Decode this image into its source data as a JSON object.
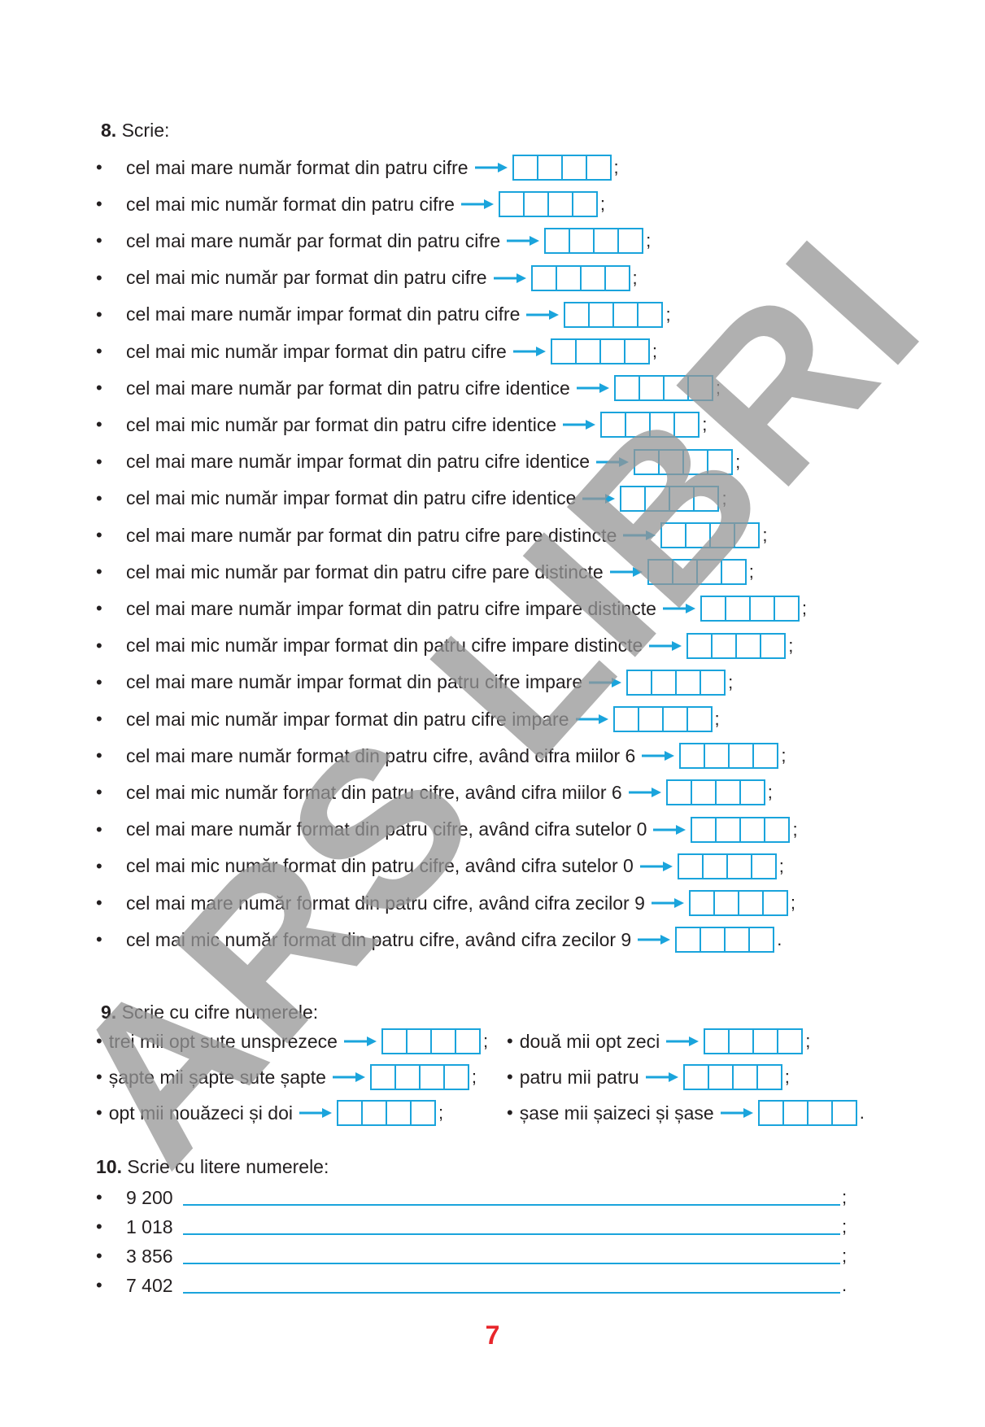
{
  "ex8": {
    "number": "8.",
    "title": "Scrie:",
    "items": [
      {
        "text": "cel mai mare număr format din patru cifre",
        "end": ";"
      },
      {
        "text": "cel mai mic număr format din patru cifre",
        "end": ";"
      },
      {
        "text": "cel mai mare număr par format din patru cifre",
        "end": ";"
      },
      {
        "text": "cel mai mic număr par format din patru cifre",
        "end": ";"
      },
      {
        "text": "cel mai mare număr impar format din patru cifre",
        "end": ";"
      },
      {
        "text": "cel mai mic număr impar format din patru cifre",
        "end": ";"
      },
      {
        "text": "cel mai mare număr par format din patru cifre identice",
        "end": ";"
      },
      {
        "text": "cel mai mic număr par format din patru cifre identice",
        "end": ";"
      },
      {
        "text": "cel mai mare număr impar format din patru cifre identice",
        "end": ";"
      },
      {
        "text": "cel mai mic număr impar format din patru cifre identice",
        "end": ";"
      },
      {
        "text": "cel mai mare număr par format din patru cifre pare distincte",
        "end": ";"
      },
      {
        "text": "cel mai mic număr par format din patru cifre pare distincte",
        "end": ";"
      },
      {
        "text": "cel mai mare număr impar format din patru cifre impare distincte",
        "end": ";"
      },
      {
        "text": "cel mai mic număr impar format din patru cifre impare distincte",
        "end": ";"
      },
      {
        "text": "cel mai mare număr impar format din patru cifre impare",
        "end": ";"
      },
      {
        "text": "cel mai mic număr impar format din patru cifre impare",
        "end": ";"
      },
      {
        "text": "cel mai mare număr format din patru cifre, având cifra miilor 6",
        "end": ";"
      },
      {
        "text": "cel mai mic număr format din patru cifre, având cifra miilor 6",
        "end": ";"
      },
      {
        "text": "cel mai mare număr format din patru cifre, având cifra sutelor 0",
        "end": ";"
      },
      {
        "text": "cel mai mic număr format din patru cifre, având cifra sutelor 0",
        "end": ";"
      },
      {
        "text": "cel mai mare număr format din patru cifre, având cifra zecilor 9",
        "end": ";"
      },
      {
        "text": "cel mai mic număr format din patru cifre, având cifra zecilor 9",
        "end": "."
      }
    ]
  },
  "ex9": {
    "number": "9.",
    "title": "Scrie cu cifre numerele:",
    "left": [
      {
        "text": "trei mii opt sute unsprezece",
        "end": ";"
      },
      {
        "text": "șapte mii șapte sute șapte",
        "end": ";"
      },
      {
        "text": "opt mii nouăzeci și doi",
        "end": ";"
      }
    ],
    "right": [
      {
        "text": "două mii opt zeci",
        "end": ";"
      },
      {
        "text": "patru mii patru",
        "end": ";"
      },
      {
        "text": "șase mii șaizeci și șase",
        "end": "."
      }
    ]
  },
  "ex10": {
    "number": "10.",
    "title": "Scrie cu litere numerele:",
    "items": [
      {
        "text": "9 200",
        "end": ";"
      },
      {
        "text": "1 018",
        "end": ";"
      },
      {
        "text": "3 856",
        "end": ";"
      },
      {
        "text": "7 402",
        "end": "."
      }
    ]
  },
  "bullet": "•",
  "page_number": "7",
  "watermark": "ARS LIBRI",
  "colors": {
    "accent": "#1aa4dc",
    "page_number": "#e8262b",
    "watermark": "#969696"
  }
}
